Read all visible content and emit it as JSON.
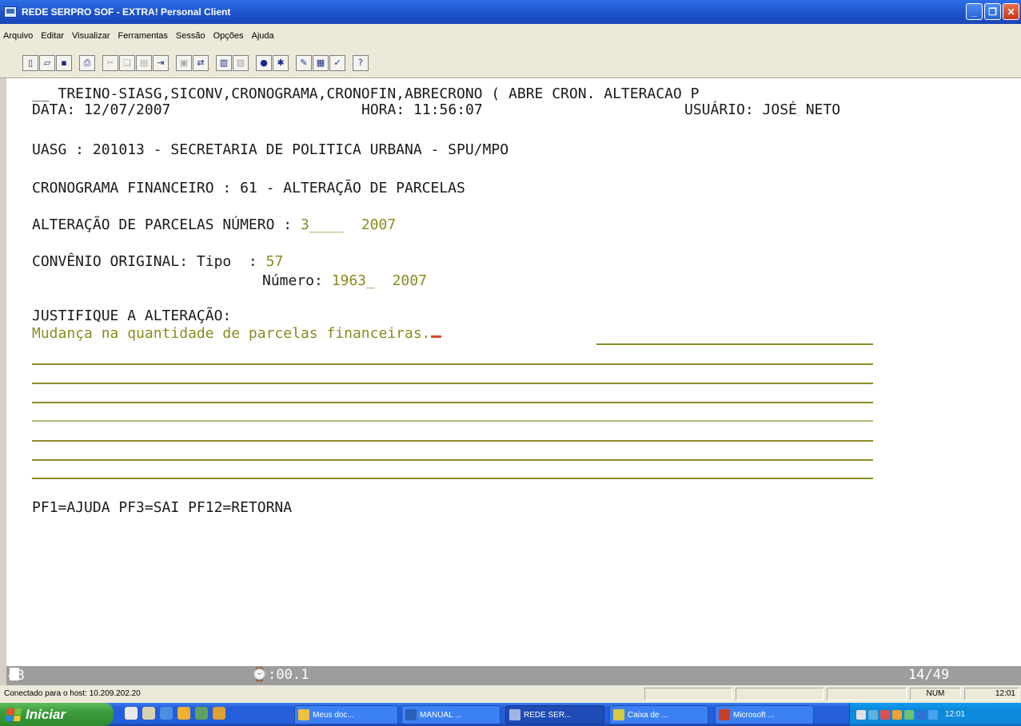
{
  "window": {
    "title": "REDE SERPRO SOF - EXTRA! Personal Client"
  },
  "menu": [
    "Arquivo",
    "Editar",
    "Visualizar",
    "Ferramentas",
    "Sessão",
    "Opções",
    "Ajuda"
  ],
  "terminal": {
    "line1": "__ TREINO-SIASG,SICONV,CRONOGRAMA,CRONOFIN,ABRECRONO ( ABRE CRON. ALTERACAO P",
    "data_label": "DATA: 12/07/2007",
    "hora_label": "HORA: 11:56:07",
    "usuario_label": "USUÁRIO: JOSÉ NETO",
    "uasg": "UASG : 201013 - SECRETARIA DE POLITICA URBANA - SPU/MPO",
    "cronograma": "CRONOGRAMA FINANCEIRO : 61 - ALTERAÇÃO DE PARCELAS",
    "alteracao_label": "ALTERAÇÃO DE PARCELAS NÚMERO : ",
    "alteracao_numero": "3____",
    "alteracao_ano": "2007",
    "convenio_label": "CONVÊNIO ORIGINAL: Tipo  : ",
    "convenio_tipo": "57",
    "numero_label": "Número: ",
    "convenio_numero": "1963_",
    "convenio_ano": "2007",
    "justifique_label": "JUSTIFIQUE A ALTERAÇÃO:",
    "justificativa": "Mudança na quantidade de parcelas financeiras.",
    "pf_keys": "PF1=AJUDA PF3=SAI PF12=RETORNA"
  },
  "terminal_status": {
    "left": "4B",
    "timer": "⌚:00.1",
    "cursor_pos": "14/49"
  },
  "client_status": {
    "connection": "Conectado para o host: 10.209.202.20",
    "num": "NUM",
    "time": "12:01"
  },
  "taskbar": {
    "start_label": "Iniciar",
    "tasks": [
      {
        "label": "Meus doc...",
        "color": "#f0c040"
      },
      {
        "label": "MANUAL ...",
        "color": "#2b5fb8"
      },
      {
        "label": "REDE SER...",
        "color": "#9fb7e0"
      },
      {
        "label": "Caixa de ...",
        "color": "#d6c840"
      },
      {
        "label": "Microsoft ...",
        "color": "#c8402a"
      }
    ],
    "clock": "12:01"
  },
  "colors": {
    "field_value": "#8a8a1e",
    "cursor": "#d64a2c",
    "title_bar": "#1c50c9",
    "terminal_bg": "#ffffff",
    "status_bg": "#9d9d9d"
  }
}
